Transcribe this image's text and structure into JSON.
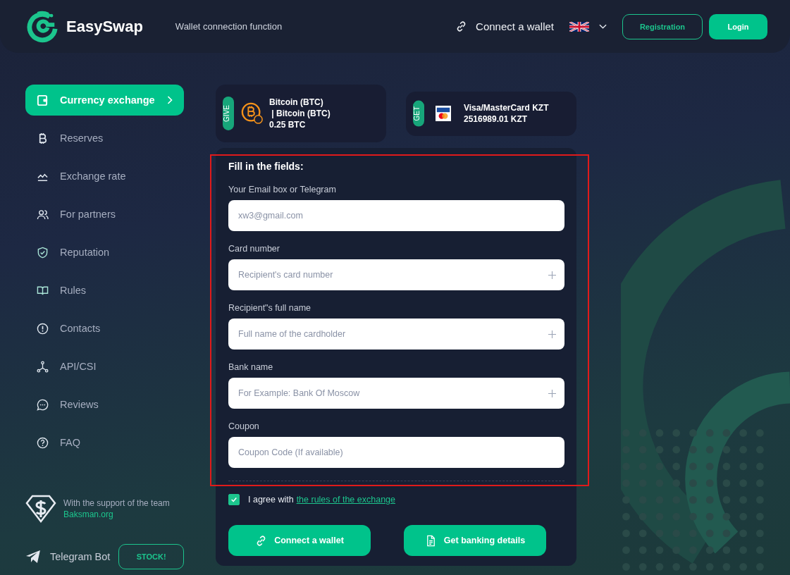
{
  "header": {
    "brand": "EasySwap",
    "subtitle": "Wallet connection function",
    "connect_link": "Connect a wallet",
    "registration": "Registration",
    "login": "Login"
  },
  "sidebar": {
    "items": [
      {
        "label": "Currency exchange",
        "selected": true
      },
      {
        "label": "Reserves",
        "selected": false
      },
      {
        "label": "Exchange rate",
        "selected": false
      },
      {
        "label": "For partners",
        "selected": false
      },
      {
        "label": "Reputation",
        "selected": false
      },
      {
        "label": "Rules",
        "selected": false
      },
      {
        "label": "Contacts",
        "selected": false
      },
      {
        "label": "API/CSI",
        "selected": false
      },
      {
        "label": "Reviews",
        "selected": false
      },
      {
        "label": "FAQ",
        "selected": false
      }
    ],
    "support": {
      "text": "With the support of the team",
      "link": "Baksman.org"
    },
    "telegram": {
      "label": "Telegram Bot",
      "button": "STOCK!"
    }
  },
  "exchange": {
    "give": {
      "badge": "GIVE",
      "lines": [
        "Bitcoin (BTC)",
        " | Bitcoin (BTC)",
        "0.25 BTC"
      ]
    },
    "get": {
      "badge": "GET",
      "lines": [
        "Visa/MasterCard KZT",
        "2516989.01 KZT"
      ]
    }
  },
  "form": {
    "title": "Fill in the fields:",
    "fields": [
      {
        "label": "Your Email box or Telegram",
        "placeholder": "xw3@gmail.com",
        "kind": "plain"
      },
      {
        "label": "Card number",
        "placeholder": "Recipient's card number",
        "kind": "addable"
      },
      {
        "label": "Recipient\"s full name",
        "placeholder": "Full name of the cardholder",
        "kind": "addable"
      },
      {
        "label": "Bank name",
        "placeholder": "For Example: Bank Of Moscow",
        "kind": "addable"
      },
      {
        "label": "Coupon",
        "placeholder": "Coupon Code (If available)",
        "kind": "plain"
      }
    ],
    "agree": {
      "checked": true,
      "text": "I agree with",
      "link": "the rules of the exchange"
    },
    "buttons": [
      {
        "label": "Connect a wallet"
      },
      {
        "label": "Get banking details"
      }
    ]
  }
}
